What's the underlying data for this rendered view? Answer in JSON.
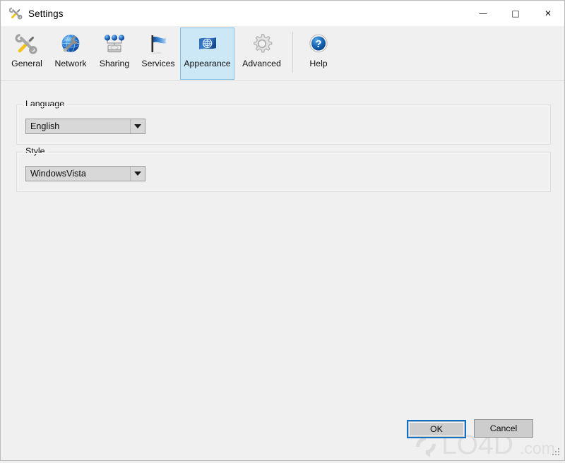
{
  "window": {
    "title": "Settings",
    "title_icon": "tools-icon",
    "controls": [
      {
        "name": "minimize-button",
        "glyph": "—"
      },
      {
        "name": "maximize-button",
        "glyph": "□"
      },
      {
        "name": "close-button",
        "glyph": "✕"
      }
    ]
  },
  "toolbar": {
    "items": [
      {
        "label": "General",
        "icon": "tools-icon",
        "selected": false
      },
      {
        "label": "Network",
        "icon": "globe-wrench-icon",
        "selected": false
      },
      {
        "label": "Sharing",
        "icon": "share-nodes-icon",
        "selected": false
      },
      {
        "label": "Services",
        "icon": "flag-icon",
        "selected": false
      },
      {
        "label": "Appearance",
        "icon": "un-flag-icon",
        "selected": true
      },
      {
        "label": "Advanced",
        "icon": "gear-icon",
        "selected": false
      }
    ],
    "help": {
      "label": "Help",
      "icon": "question-mark-icon"
    }
  },
  "groups": [
    {
      "label": "Language",
      "combo": {
        "name": "language-select",
        "value": "English",
        "options": [
          "English"
        ]
      }
    },
    {
      "label": "Style",
      "combo": {
        "name": "style-select",
        "value": "WindowsVista",
        "options": [
          "WindowsVista"
        ]
      }
    }
  ],
  "footer": {
    "ok_label": "OK",
    "cancel_label": "Cancel"
  },
  "watermark": {
    "text_main": "LO4D",
    "text_suffix": ".com"
  },
  "colors": {
    "accent": "#0e6fc4",
    "selection_fill": "#cce8f7",
    "selection_border": "#7cc0e8",
    "window_bg": "#f0f0f0",
    "titlebar_bg": "#ffffff",
    "control_bg": "#cdcdcd"
  }
}
